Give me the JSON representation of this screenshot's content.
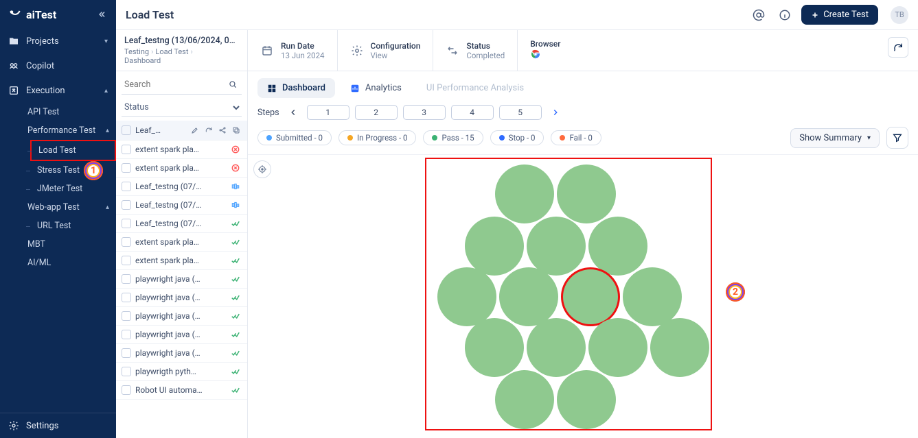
{
  "app": {
    "name": "aiTest",
    "user_initials": "TB"
  },
  "topbar": {
    "title": "Load Test",
    "create_label": "Create Test"
  },
  "sidebar": {
    "projects": "Projects",
    "copilot": "Copilot",
    "execution": "Execution",
    "settings": "Settings",
    "exec_items": {
      "api_test": "API Test",
      "perf_test": "Performance Test",
      "load_test": "Load Test",
      "stress_test": "Stress Test",
      "jmeter_test": "JMeter Test",
      "webapp_test": "Web-app Test",
      "url_test": "URL Test",
      "mbt": "MBT",
      "aiml": "AI/ML"
    }
  },
  "crumbs": {
    "title": "Leaf_testng (13/06/2024, 0…",
    "project": "Testing",
    "type": "Load Test",
    "page": "Dashboard"
  },
  "meta": {
    "run_date_label": "Run Date",
    "run_date_value": "13 Jun 2024",
    "config_label": "Configuration",
    "config_value": "View",
    "status_label": "Status",
    "status_value": "Completed",
    "browser_label": "Browser"
  },
  "list": {
    "search_placeholder": "Search",
    "status_placeholder": "Status",
    "items": [
      {
        "name": "Leaf_…",
        "selected": true,
        "actions": true
      },
      {
        "name": "extent spark pla…",
        "status": "fail"
      },
      {
        "name": "extent spark pla…",
        "status": "fail"
      },
      {
        "name": "Leaf_testng (07/…",
        "status": "running"
      },
      {
        "name": "Leaf_testng (07/…",
        "status": "running"
      },
      {
        "name": "Leaf_testng (07/…",
        "status": "pass"
      },
      {
        "name": "extent spark pla…",
        "status": "pass"
      },
      {
        "name": "extent spark pla…",
        "status": "pass"
      },
      {
        "name": "playwright java (…",
        "status": "pass"
      },
      {
        "name": "playwright java (…",
        "status": "pass"
      },
      {
        "name": "playwright java (…",
        "status": "pass"
      },
      {
        "name": "playwright java (…",
        "status": "pass"
      },
      {
        "name": "playwright java (…",
        "status": "pass"
      },
      {
        "name": "playwrigth pyth…",
        "status": "pass"
      },
      {
        "name": "Robot UI automa…",
        "status": "pass"
      }
    ]
  },
  "tabs": {
    "dashboard": "Dashboard",
    "analytics": "Analytics",
    "ui_perf": "UI Performance Analysis"
  },
  "steps": {
    "label": "Steps",
    "values": [
      "1",
      "2",
      "3",
      "4",
      "5"
    ]
  },
  "chips": {
    "submitted": "Submitted - 0",
    "inprogress": "In Progress - 0",
    "pass": "Pass - 15",
    "stop": "Stop - 0",
    "fail": "Fail - 0",
    "show_summary": "Show Summary"
  },
  "colors": {
    "submitted": "#4da3ff",
    "inprogress": "#f5a623",
    "pass": "#3bb273",
    "stop": "#2f6bff",
    "fail": "#ff6a3d"
  },
  "annotations": {
    "one": "1",
    "two": "2"
  }
}
